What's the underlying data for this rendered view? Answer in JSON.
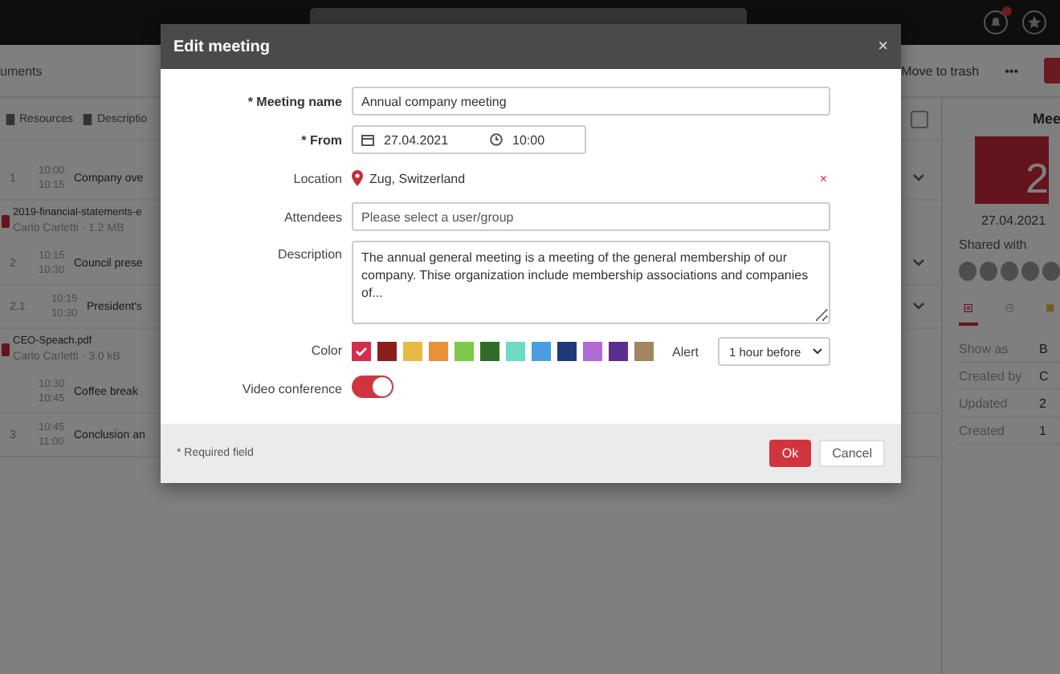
{
  "app": {
    "tab": "uments",
    "actions": [
      "Move to trash",
      "•••"
    ],
    "toolbar": [
      "Resources",
      "Descriptio"
    ],
    "select_all": {
      "checked": false
    },
    "agenda": [
      {
        "kind": "item",
        "number": "1",
        "start": "10:00",
        "end": "10:15",
        "title": "Company ove",
        "expandable": true
      },
      {
        "kind": "file",
        "name": "2019-financial-statements-e",
        "meta": "Carlo Carletti · 1.2 MB"
      },
      {
        "kind": "item",
        "number": "2",
        "start": "10:15",
        "end": "10:30",
        "title": "Council prese",
        "expandable": true
      },
      {
        "kind": "subitem",
        "number": "2.1",
        "start": "10:15",
        "end": "10:30",
        "title": "President's",
        "expandable": true
      },
      {
        "kind": "file",
        "name": "CEO-Speach.pdf",
        "meta": "Carlo Carletti · 3.0 kB"
      },
      {
        "kind": "item",
        "start": "10:30",
        "end": "10:45",
        "title": "Coffee break",
        "expandable": false
      },
      {
        "kind": "item",
        "number": "3",
        "start": "10:45",
        "end": "11:00",
        "title": "Conclusion an",
        "expandable": false
      }
    ],
    "panel": {
      "title": "Mee",
      "day": "2",
      "date": "27.04.2021",
      "shared_label": "Shared with",
      "details": [
        {
          "label": "Show as",
          "value": "B"
        },
        {
          "label": "Created by",
          "value": "C"
        },
        {
          "label": "Updated",
          "value": "2"
        },
        {
          "label": "Created",
          "value": "1"
        }
      ]
    }
  },
  "dialog": {
    "title": "Edit meeting",
    "close": "×",
    "meeting_name": {
      "label": "* Meeting name",
      "value": "Annual company meeting"
    },
    "from": {
      "label": "* From",
      "date": "27.04.2021",
      "time": "10:00"
    },
    "location": {
      "label": "Location",
      "value": "Zug, Switzerland",
      "clear": "×"
    },
    "attendees": {
      "label": "Attendees",
      "placeholder": "Please select a user/group"
    },
    "description": {
      "label": "Description",
      "value": "The annual general meeting is a meeting of the general membership of our company. Thise organization include membership associations and companies of..."
    },
    "color": {
      "label": "Color",
      "swatches": [
        {
          "color": "#d42e4e",
          "selected": true
        },
        {
          "color": "#8a1f1a",
          "selected": false
        },
        {
          "color": "#e8b943",
          "selected": false
        },
        {
          "color": "#e8913a",
          "selected": false
        },
        {
          "color": "#7cc94a",
          "selected": false
        },
        {
          "color": "#2e6e26",
          "selected": false
        },
        {
          "color": "#6ddbc5",
          "selected": false
        },
        {
          "color": "#4a9de0",
          "selected": false
        },
        {
          "color": "#1f3a7a",
          "selected": false
        },
        {
          "color": "#b06ad6",
          "selected": false
        },
        {
          "color": "#5b2e8f",
          "selected": false
        },
        {
          "color": "#a08660",
          "selected": false
        }
      ]
    },
    "alert": {
      "label": "Alert",
      "value": "1 hour before"
    },
    "video_conference": {
      "label": "Video conference",
      "on": true
    },
    "footnote": "* Required field",
    "buttons": [
      {
        "kind": "primary",
        "label": "Ok"
      },
      {
        "kind": "secondary",
        "label": "Cancel"
      }
    ]
  }
}
